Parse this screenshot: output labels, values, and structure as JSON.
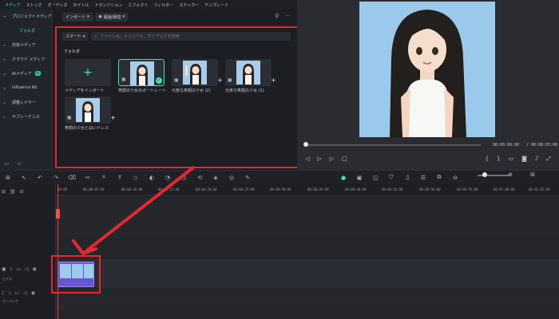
{
  "top_menu": [
    "メディア",
    "ストック",
    "オーディオ",
    "タイトル",
    "トランジション",
    "エフェクト",
    "フィルター",
    "ステッカー",
    "テンプレート"
  ],
  "left_nav": {
    "project_media": "プロジェクトメディア",
    "folder": "フォルダ",
    "shared_media": "共有メディア",
    "cloud_media": "クラウド メディア",
    "ai_media": "AIメディア",
    "ai_badge": "AI",
    "influence_kit": "Influence Kit",
    "adjust_layer": "調整レイヤー",
    "sub_sequence": "サブシーケンス"
  },
  "media_toolbar": {
    "import": "インポート",
    "record": "録画/録音"
  },
  "search": {
    "smart_label": "スマート",
    "placeholder": "ファイル名、ビジュアル、ダイアログを検索"
  },
  "folder_label": "フォルダ",
  "media_items": [
    {
      "label": "メディアをインポート"
    },
    {
      "label": "笑顔の少女のポートレート"
    },
    {
      "label": "元気な笑顔の少女 (2)"
    },
    {
      "label": "元気な笑顔の少女 (1)"
    },
    {
      "label": "笑顔の少女と白いドレス"
    }
  ],
  "player": {
    "current_time": "00:00:00:00",
    "separator": "/",
    "total_time": "00:00:05:00"
  },
  "timeline": {
    "ruler_ticks": [
      "00:00",
      "00:00:05:00",
      "00:00:10:00",
      "00:00:15:00",
      "00:00:20:00",
      "00:00:25:00",
      "00:00:30:00",
      "00:00:35:00",
      "00:00:40:00",
      "00:00:45:00",
      "00:00:50:00",
      "00:00:55:00",
      "00:01:00:00",
      "00:01:05:00"
    ],
    "video_track": "ビデオ",
    "audio_track": "オーディオ",
    "video_track_num": "1",
    "audio_track_num": "1"
  },
  "colors": {
    "accent": "#3de3b8",
    "highlight_red": "#e8272f",
    "clip_purple": "#6a55d6"
  }
}
